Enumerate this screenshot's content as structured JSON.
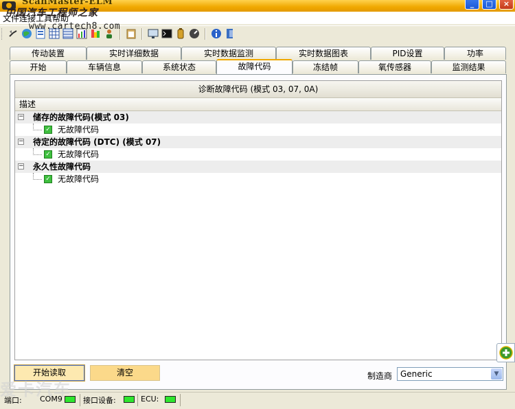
{
  "window": {
    "title": "ScanMaster-ELM",
    "watermark_top": "中国汽车工程师之家",
    "watermark_site": "www.cartech8.com",
    "watermark_bottom": "爱卡汽车"
  },
  "menu": {
    "text": "文件连接工具帮助"
  },
  "toolbar": {
    "icons": [
      "connect-icon",
      "globe-icon",
      "document-icon",
      "grid-icon",
      "chart-icon",
      "colorbar-icon",
      "user-icon",
      "clipboard-icon",
      "monitor-icon",
      "terminal-icon",
      "battery-icon",
      "gauge-icon",
      "info-icon",
      "exit-icon"
    ]
  },
  "tabs": {
    "row1": [
      "传动装置",
      "实时详细数据",
      "实时数据监测",
      "实时数据图表",
      "PID设置",
      "功率"
    ],
    "row2": [
      "开始",
      "车辆信息",
      "系统状态",
      "故障代码",
      "冻结帧",
      "氧传感器",
      "监测结果"
    ],
    "active": "故障代码"
  },
  "grid": {
    "title": "诊断故障代码 (模式 03, 07, 0A)",
    "column": "描述",
    "groups": [
      {
        "label": "储存的故障代码(模式 03)",
        "child": "无故障代码"
      },
      {
        "label": "待定的故障代码 (DTC) (模式 07)",
        "child": "无故障代码"
      },
      {
        "label": "永久性故障代码",
        "child": "无故障代码"
      }
    ],
    "expander_symbol": "−"
  },
  "buttons": {
    "read": "开始读取",
    "clear": "清空"
  },
  "manufacturer": {
    "label": "制造商",
    "value": "Generic"
  },
  "status": {
    "port_label": "端口:",
    "port_value": "COM9",
    "iface_label": "接口设备:",
    "ecu_label": "ECU:",
    "led_color": "#2ee62e"
  },
  "colors": {
    "titlebar": "#f0a800",
    "active_tab": "#f0a800",
    "button_fill": "#fbd98a"
  }
}
